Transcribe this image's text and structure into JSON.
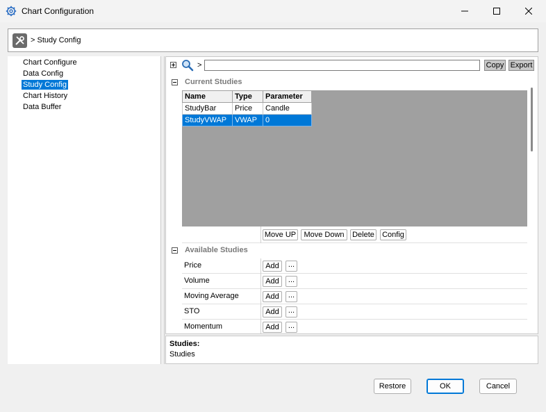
{
  "window": {
    "title": "Chart Configuration"
  },
  "breadcrumb": {
    "text": "> Study Config"
  },
  "tree": {
    "items": [
      {
        "label": "Chart Configure"
      },
      {
        "label": "Data Config"
      },
      {
        "label": "Study Config",
        "selected": true
      },
      {
        "label": "Chart History"
      },
      {
        "label": "Data Buffer"
      }
    ]
  },
  "toolbar": {
    "separator": ">",
    "search_value": "",
    "copy_label": "Copy",
    "export_label": "Export"
  },
  "current_studies": {
    "heading": "Current Studies",
    "columns": [
      "Name",
      "Type",
      "Parameter"
    ],
    "rows": [
      [
        "StudyBar",
        "Price",
        "Candle"
      ],
      [
        "StudyVWAP",
        "VWAP",
        "0"
      ]
    ],
    "selected_row": 1,
    "actions": {
      "move_up": "Move UP",
      "move_down": "Move Down",
      "delete": "Delete",
      "config": "Config"
    }
  },
  "available_studies": {
    "heading": "Available Studies",
    "add_label": "Add",
    "more_label": "...",
    "items": [
      "Price",
      "Volume",
      "Moving Average",
      "STO",
      "Momentum"
    ]
  },
  "help": {
    "title": "Studies:",
    "body": "Studies"
  },
  "footer": {
    "restore": "Restore",
    "ok": "OK",
    "cancel": "Cancel"
  },
  "colors": {
    "selection": "#0078d7",
    "grid_background": "#a0a0a0"
  }
}
